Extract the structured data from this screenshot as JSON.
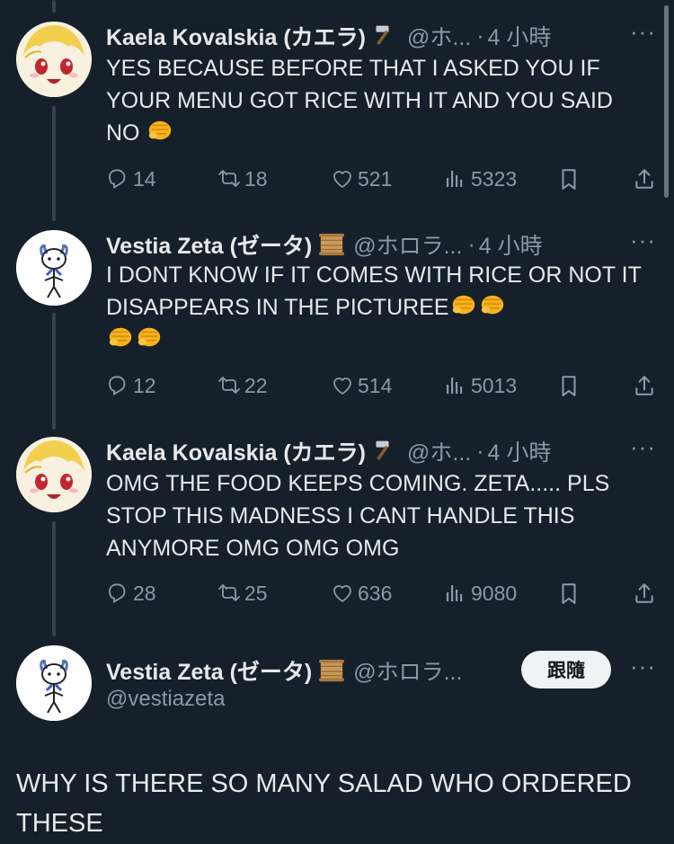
{
  "replies": [
    {
      "name": "Kaela Kovalskia (カエラ)",
      "name_emoji": "hammer-icon",
      "handle": "@ホ...",
      "time": "4 小時",
      "text": "YES BECAUSE BEFORE THAT I ASKED YOU IF YOUR MENU GOT RICE WITH IT AND YOU SAID NO",
      "fists": 1,
      "replies": "14",
      "retweets": "18",
      "likes": "521",
      "views": "5323"
    },
    {
      "name": "Vestia Zeta (ゼータ)",
      "name_emoji": "scroll-icon",
      "handle": "@ホロラ...",
      "time": "4 小時",
      "text": "I DONT KNOW IF IT COMES WITH RICE OR NOT IT DISAPPEARS IN THE PICTUREE",
      "fists": 4,
      "replies": "12",
      "retweets": "22",
      "likes": "514",
      "views": "5013"
    },
    {
      "name": "Kaela Kovalskia (カエラ)",
      "name_emoji": "hammer-icon",
      "handle": "@ホ...",
      "time": "4 小時",
      "text": "OMG THE FOOD KEEPS COMING. ZETA..... PLS STOP THIS MADNESS I CANT HANDLE THIS ANYMORE OMG OMG OMG",
      "fists": 0,
      "replies": "28",
      "retweets": "25",
      "likes": "636",
      "views": "9080"
    }
  ],
  "main_tweet": {
    "name": "Vestia Zeta (ゼータ)",
    "name_emoji": "scroll-icon",
    "handle_short": "@ホロラ...",
    "handle": "@vestiazeta",
    "follow_label": "跟隨",
    "text": "WHY IS THERE SO MANY SALAD WHO ORDERED THESE"
  },
  "more_label": "···",
  "dot": "·",
  "colors": {
    "background": "#15202b",
    "text": "#e7e9ea",
    "muted": "#8b98a5",
    "thread_line": "#38444d",
    "follow_button": "#eff3f4"
  }
}
